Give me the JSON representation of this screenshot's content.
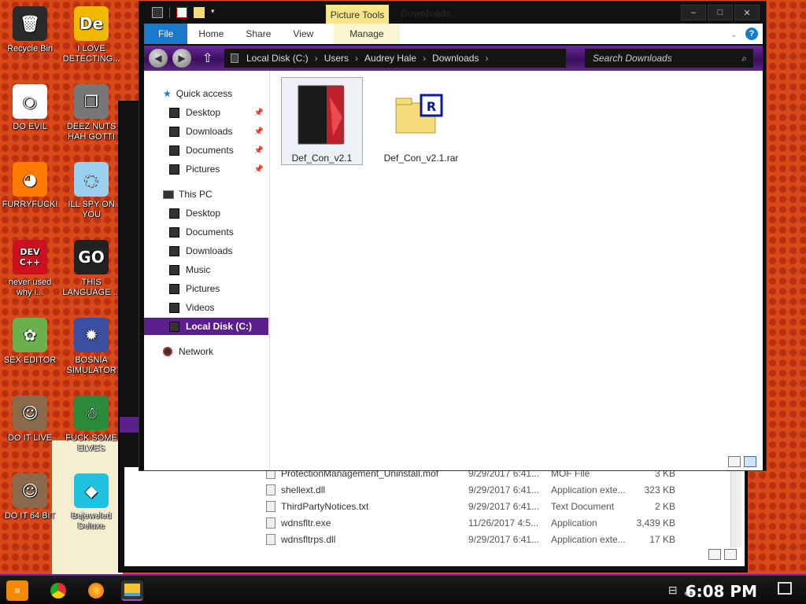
{
  "desktop_icons": [
    {
      "label": "Recycle Bin",
      "glyph": "🗑",
      "color": "#2a2a2a"
    },
    {
      "label": "I LOVE DETECTING...",
      "glyph": "De",
      "color": "#f0b800"
    },
    {
      "label": "DO EVIL",
      "glyph": "◉",
      "color": "#ffffff"
    },
    {
      "label": "DEEZ NUTS HAH GOTTI",
      "glyph": "❐",
      "color": "#777777"
    },
    {
      "label": "FURRYFUCK!",
      "glyph": "◕",
      "color": "#ff7a00"
    },
    {
      "label": "ILL SPY ON YOU",
      "glyph": "◌",
      "color": "#9ad0f0"
    },
    {
      "label": "never used why i...",
      "glyph": "DEV C++",
      "color": "#cc1020"
    },
    {
      "label": "THIS LANGUAGE ...",
      "glyph": "GO",
      "color": "#222222"
    },
    {
      "label": "SEX EDITOR",
      "glyph": "✿",
      "color": "#6ab04c"
    },
    {
      "label": "BOSNIA SIMULATOR",
      "glyph": "✹",
      "color": "#3b4fa0"
    },
    {
      "label": "DO IT LIVE",
      "glyph": "☺",
      "color": "#8a6a4a"
    },
    {
      "label": "FUCK SOME ELVES",
      "glyph": "☃",
      "color": "#2a8a3a"
    },
    {
      "label": "DO IT 64 BIT",
      "glyph": "☺",
      "color": "#8a6a4a"
    },
    {
      "label": "Bejeweled Deluxe",
      "glyph": "◆",
      "color": "#20c0e0"
    }
  ],
  "window": {
    "title": "Downloads",
    "picture_tools_label": "Picture Tools",
    "tabs": {
      "file": "File",
      "home": "Home",
      "share": "Share",
      "view": "View",
      "manage": "Manage"
    },
    "help_label": "?",
    "controls": {
      "minimize": "–",
      "maximize": "□",
      "close": "✕"
    }
  },
  "address": {
    "crumbs": [
      "Local Disk (C:)",
      "Users",
      "Audrey Hale",
      "Downloads"
    ],
    "search_placeholder": "Search Downloads"
  },
  "nav": {
    "quick_access": "Quick access",
    "quick_items": [
      "Desktop",
      "Downloads",
      "Documents",
      "Pictures"
    ],
    "this_pc": "This PC",
    "pc_items": [
      "Desktop",
      "Documents",
      "Downloads",
      "Music",
      "Pictures",
      "Videos"
    ],
    "local_disk": "Local Disk (C:)",
    "network": "Network"
  },
  "files": [
    {
      "name": "Def_Con_v2.1",
      "type": "app"
    },
    {
      "name": "Def_Con_v2.1.rar",
      "type": "rar"
    }
  ],
  "background_window": {
    "rows": [
      {
        "name": "ProtectionManagement_Uninstall.mof",
        "date": "9/29/2017 6:41...",
        "type": "MOF File",
        "size": "3 KB"
      },
      {
        "name": "shellext.dll",
        "date": "9/29/2017 6:41...",
        "type": "Application exte...",
        "size": "323 KB"
      },
      {
        "name": "ThirdPartyNotices.txt",
        "date": "9/29/2017 6:41...",
        "type": "Text Document",
        "size": "2 KB"
      },
      {
        "name": "wdnsfltr.exe",
        "date": "11/26/2017 4:5...",
        "type": "Application",
        "size": "3,439 KB"
      },
      {
        "name": "wdnsfltrps.dll",
        "date": "9/29/2017 6:41...",
        "type": "Application exte...",
        "size": "17 KB"
      }
    ]
  },
  "taskbar": {
    "clock": "6:08 PM"
  }
}
